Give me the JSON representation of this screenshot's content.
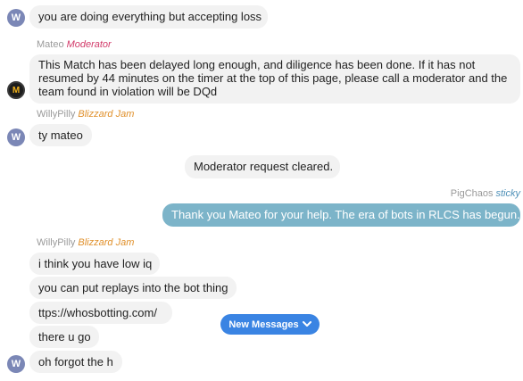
{
  "messages": {
    "m1": {
      "avatar": "W",
      "text": "you are doing everything but accepting loss"
    },
    "m2": {
      "sender": "Mateo",
      "role": "Moderator",
      "avatar": "M",
      "text": "This Match has been delayed long enough, and diligence has been done. If it has not resumed by 44 minutes on the timer at the top of this page, please call a moderator and the team found in violation will be DQd"
    },
    "m3": {
      "sender": "WillyPilly",
      "role": "Blizzard Jam",
      "avatar": "W",
      "text": "ty mateo"
    },
    "system": {
      "text": "Moderator request cleared."
    },
    "m4": {
      "sender": "PigChaos",
      "role": "sticky",
      "text": "Thank you Mateo for your help. The era of bots in RLCS has begun."
    },
    "m5": {
      "sender": "WillyPilly",
      "role": "Blizzard Jam",
      "avatar": "W",
      "lines": [
        "i think you have low iq",
        "you can put replays into the bot thing",
        "ttps://whosbotting.com/",
        "there u go",
        "oh forgot the h"
      ]
    }
  },
  "new_messages_button": {
    "label": "New Messages",
    "icon": "chevron-down-icon"
  },
  "colors": {
    "bubble": "#f2f2f2",
    "own_bubble": "#7cb4c9",
    "moderator_role": "#d23b6a",
    "jam_role": "#e0902b",
    "sticky_role": "#4e90b8",
    "new_messages": "#3a84e3",
    "avatar": "#7b87b6"
  }
}
